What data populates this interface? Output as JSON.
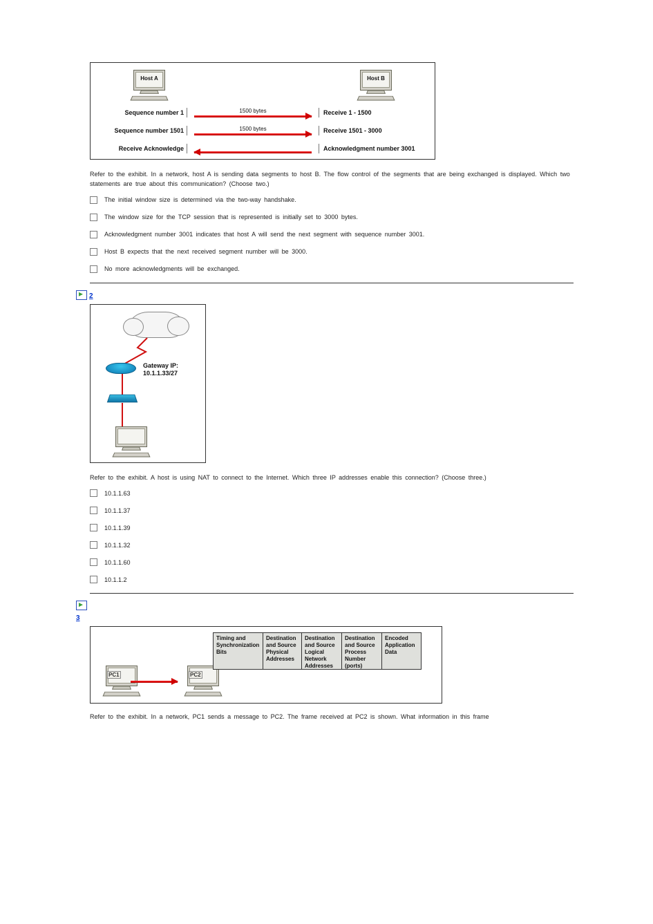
{
  "q1": {
    "hostA": "Host A",
    "hostB": "Host B",
    "rows": [
      {
        "left": "Sequence number 1",
        "bytes": "1500 bytes",
        "dir": "right",
        "right": "Receive 1 - 1500"
      },
      {
        "left": "Sequence number 1501",
        "bytes": "1500 bytes",
        "dir": "right",
        "right": "Receive 1501 - 3000"
      },
      {
        "left": "Receive Acknowledge",
        "bytes": "",
        "dir": "left",
        "right": "Acknowledgment number 3001"
      }
    ],
    "text": "Refer to the exhibit. In a network, host A is sending data segments to host B. The flow control of the segments that are being exchanged is displayed. Which two statements are true about this communication? (Choose two.)",
    "options": [
      "The initial window size is determined via the two-way handshake.",
      "The window size for the TCP session that is represented is initially set to 3000 bytes.",
      "Acknowledgment number 3001 indicates that host A will send the next segment with sequence number 3001.",
      "Host B expects that the next received segment number will be 3000.",
      "No more acknowledgments will be exchanged."
    ]
  },
  "q2": {
    "number": "2",
    "gw_l1": "Gateway IP:",
    "gw_l2": "10.1.1.33/27",
    "text": "Refer to the exhibit. A host is using NAT to connect to the Internet. Which three IP addresses enable this connection? (Choose three.)",
    "options": [
      "10.1.1.63",
      "10.1.1.37",
      "10.1.1.39",
      "10.1.1.32",
      "10.1.1.60",
      "10.1.1.2"
    ]
  },
  "q3": {
    "number": "3",
    "pc1": "PC1",
    "pc2": "PC2",
    "cells": [
      "Timing and Synchronization Bits",
      "Destination and Source Physical Addresses",
      "Destination and Source Logical Network Addresses",
      "Destination and Source Process Number (ports)",
      "Encoded Application Data"
    ],
    "text": "Refer to the exhibit. In a network, PC1 sends a message to PC2. The frame received at PC2 is shown. What information in this frame"
  }
}
